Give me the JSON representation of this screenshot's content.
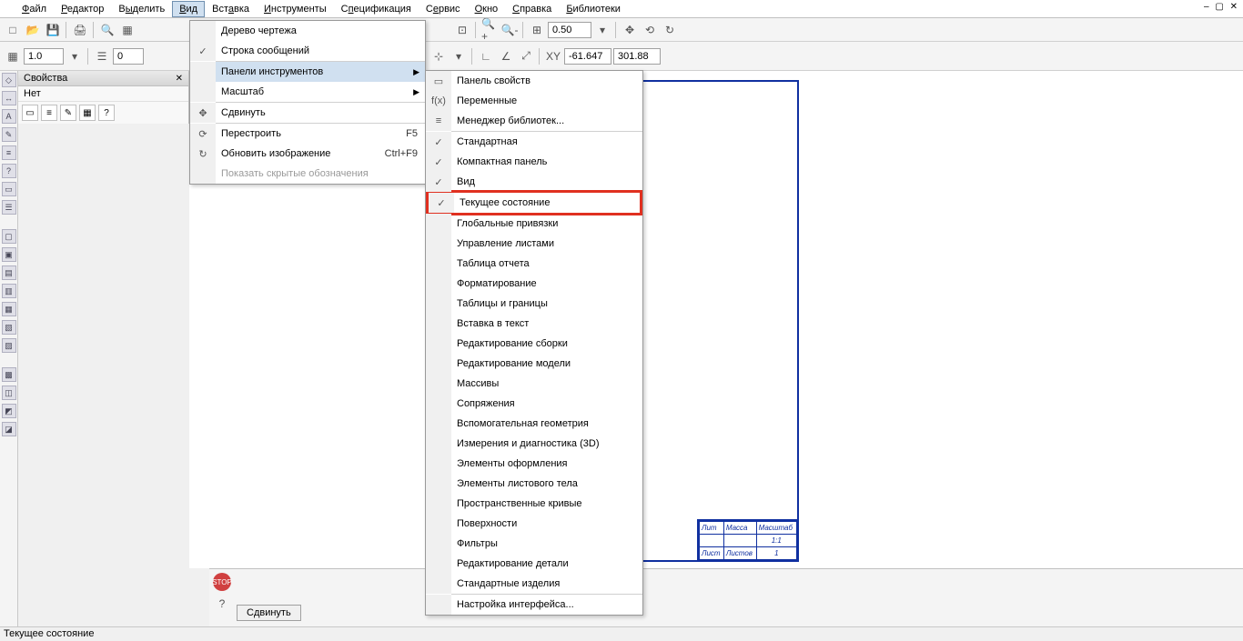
{
  "menubar": [
    "Файл",
    "Редактор",
    "Выделить",
    "Вид",
    "Вставка",
    "Инструменты",
    "Спецификация",
    "Сервис",
    "Окно",
    "Справка",
    "Библиотеки"
  ],
  "active_menu_index": 3,
  "toolbar2": {
    "scale": "1.0",
    "spin": "0"
  },
  "zoom_value": "0.50",
  "coords": {
    "x": "-61.647",
    "y": "301.88"
  },
  "props": {
    "title": "Свойства",
    "row1": "Нет"
  },
  "dropdown": [
    {
      "label": "Дерево чертежа",
      "icon": "",
      "check": false
    },
    {
      "label": "Строка сообщений",
      "icon": "",
      "check": true
    },
    {
      "sep": true
    },
    {
      "label": "Панели инструментов",
      "icon": "",
      "arrow": true,
      "hover": true
    },
    {
      "label": "Масштаб",
      "icon": "",
      "arrow": true
    },
    {
      "sep": true
    },
    {
      "label": "Сдвинуть",
      "icon": "✥"
    },
    {
      "sep": true
    },
    {
      "label": "Перестроить",
      "icon": "⟳",
      "shortcut": "F5"
    },
    {
      "label": "Обновить изображение",
      "icon": "↻",
      "shortcut": "Ctrl+F9"
    },
    {
      "label": "Показать скрытые обозначения",
      "icon": "",
      "disabled": true
    }
  ],
  "submenu": [
    {
      "label": "Панель свойств",
      "icon": "▭",
      "check": false
    },
    {
      "label": "Переменные",
      "icon": "f(x)",
      "check": false
    },
    {
      "label": "Менеджер библиотек...",
      "icon": "≡",
      "check": false
    },
    {
      "sep": true
    },
    {
      "label": "Стандартная",
      "check": true
    },
    {
      "label": "Компактная панель",
      "check": true
    },
    {
      "label": "Вид",
      "check": true
    },
    {
      "label": "Текущее состояние",
      "check": true,
      "highlight": true
    },
    {
      "label": "Глобальные привязки"
    },
    {
      "label": "Управление листами"
    },
    {
      "label": "Таблица отчета"
    },
    {
      "label": "Форматирование"
    },
    {
      "label": "Таблицы и границы"
    },
    {
      "label": "Вставка в текст"
    },
    {
      "label": "Редактирование сборки"
    },
    {
      "label": "Редактирование модели"
    },
    {
      "label": "Массивы"
    },
    {
      "label": "Сопряжения"
    },
    {
      "label": "Вспомогательная геометрия"
    },
    {
      "label": "Измерения и диагностика (3D)"
    },
    {
      "label": "Элементы оформления"
    },
    {
      "label": "Элементы листового тела"
    },
    {
      "label": "Пространственные кривые"
    },
    {
      "label": "Поверхности"
    },
    {
      "label": "Фильтры"
    },
    {
      "label": "Редактирование детали"
    },
    {
      "label": "Стандартные изделия"
    },
    {
      "sep": true
    },
    {
      "label": "Настройка интерфейса..."
    }
  ],
  "title_block": {
    "h1": "Лит",
    "h2": "Масса",
    "h3": "Масштаб",
    "v": "1:1",
    "f1": "Лист",
    "f2": "Листов",
    "f3": "1"
  },
  "bottom_button": "Сдвинуть",
  "statusbar": "Текущее состояние"
}
